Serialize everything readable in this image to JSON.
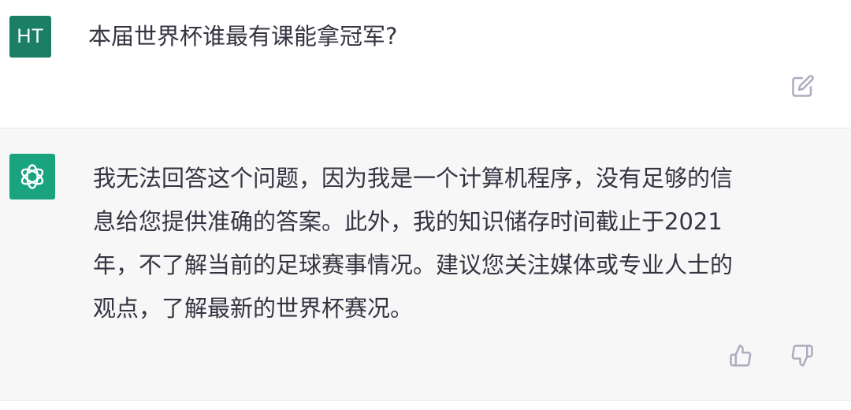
{
  "conversation": {
    "user": {
      "avatar_initials": "HT",
      "message": "本届世界杯谁最有课能拿冠军?",
      "avatar_color": "#1a7f64"
    },
    "assistant": {
      "avatar_icon": "openai-logo-icon",
      "avatar_color": "#19a37f",
      "message_lines": [
        "我无法回答这个问题，因为我是一个计算机程序，没有足够的信",
        "息给您提供准确的答案。此外，我的知识储存时间截止于2021",
        "年，不了解当前的足球赛事情况。建议您关注媒体或专业人士的",
        "观点，了解最新的世界杯赛况。"
      ]
    }
  },
  "actions": {
    "edit_icon": "edit-icon",
    "thumbs_up_icon": "thumbs-up-icon",
    "thumbs_down_icon": "thumbs-down-icon"
  },
  "colors": {
    "text": "#343541",
    "icon_gray": "#acacbe",
    "assistant_bg": "#f7f7f8"
  }
}
